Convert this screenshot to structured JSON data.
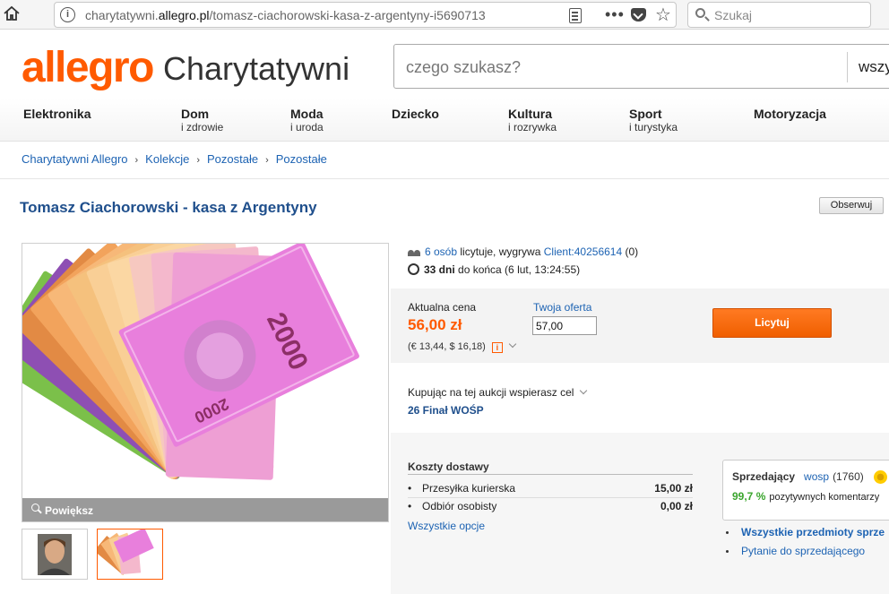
{
  "browser": {
    "url_prefix": "charytatywni.",
    "url_domain": "allegro.pl",
    "url_path": "/tomasz-ciachorowski-kasa-z-argentyny-i5690713",
    "search_placeholder": "Szukaj",
    "overflow_glyph": "•••",
    "info_glyph": "i"
  },
  "header": {
    "logo": "allegro",
    "logo_sub": "Charytatywni",
    "search_placeholder": "czego szukasz?",
    "search_category": "wszy"
  },
  "nav": {
    "items": [
      {
        "label": "Elektronika",
        "sub": ""
      },
      {
        "label": "Dom",
        "sub": "i zdrowie"
      },
      {
        "label": "Moda",
        "sub": "i uroda"
      },
      {
        "label": "Dziecko",
        "sub": ""
      },
      {
        "label": "Kultura",
        "sub": "i rozrywka"
      },
      {
        "label": "Sport",
        "sub": "i turystyka"
      },
      {
        "label": "Motoryzacja",
        "sub": ""
      }
    ]
  },
  "breadcrumb": {
    "items": [
      "Charytatywni Allegro",
      "Kolekcje",
      "Pozostałe",
      "Pozostałe"
    ],
    "separator": "›"
  },
  "product": {
    "title": "Tomasz Ciachorowski - kasa z Argentyny",
    "watch_label": "Obserwuj",
    "zoom_label": "Powiększ",
    "banknote_value": "2000"
  },
  "auction": {
    "bidders_link": "6 osób",
    "bidders_text": " licytuje, wygrywa ",
    "winner": "Client:40256614",
    "winner_score": " (0)",
    "days_left": "33 dni",
    "ends_text": " do końca (6 lut, 13:24:55)",
    "price_label": "Aktualna cena",
    "price": "56,00 zł",
    "price_conv": "(€ 13,44, $ 16,18)",
    "offer_label": "Twoja oferta",
    "offer_value": "57,00",
    "bid_button": "Licytuj"
  },
  "charity": {
    "text": "Kupując na tej aukcji wspierasz cel",
    "goal": "26 Finał WOŚP"
  },
  "shipping": {
    "title": "Koszty dostawy",
    "options": [
      {
        "name": "Przesyłka kurierska",
        "price": "15,00 zł"
      },
      {
        "name": "Odbiór osobisty",
        "price": "0,00 zł"
      }
    ],
    "all_options": "Wszystkie opcje"
  },
  "seller": {
    "label": "Sprzedający",
    "name": "wosp",
    "rating": "(1760)",
    "positive": "99,7 %",
    "positive_text": "pozytywnych komentarzy",
    "links": [
      "Wszystkie przedmioty sprze",
      "Pytanie do sprzedającego"
    ]
  },
  "colors": {
    "accent": "#ff5a00",
    "link": "#1d63b3",
    "title": "#1f4f8c",
    "positive": "#3aa52d"
  }
}
